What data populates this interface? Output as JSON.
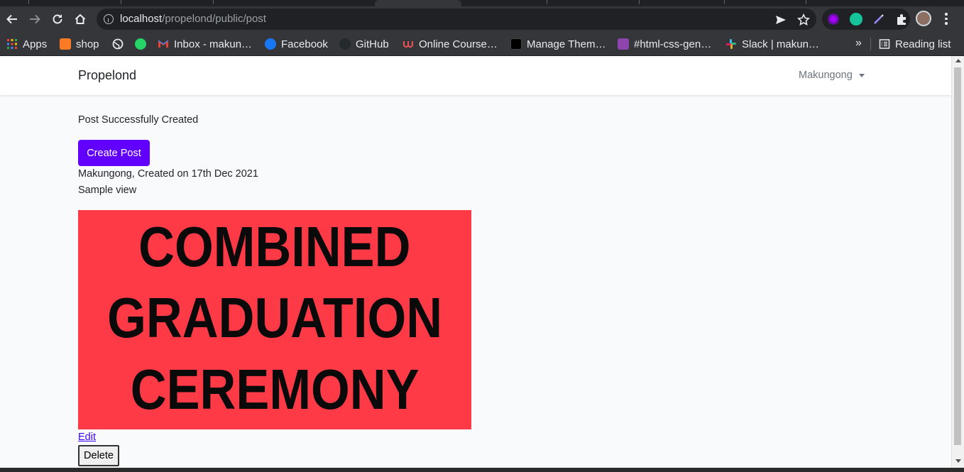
{
  "browser": {
    "url_host": "localhost",
    "url_path": "/propelond/public/post",
    "bookmarks": [
      {
        "label": "Apps",
        "icon": "apps-grid-icon",
        "color": "#ea4335"
      },
      {
        "label": "shop",
        "icon": "xampp-icon",
        "color": "#fb7a24"
      },
      {
        "label": "",
        "icon": "globe-icon",
        "color": "#e8eaed"
      },
      {
        "label": "",
        "icon": "whatsapp-icon",
        "color": "#25d366"
      },
      {
        "label": "Inbox - makun…",
        "icon": "gmail-icon",
        "color": "#ea4335"
      },
      {
        "label": "Facebook",
        "icon": "facebook-icon",
        "color": "#1877f2"
      },
      {
        "label": "GitHub",
        "icon": "github-icon",
        "color": "#24292e"
      },
      {
        "label": "Online Course…",
        "icon": "udemy-icon",
        "color": "#ec5252"
      },
      {
        "label": "Manage Them…",
        "icon": "themeforest-icon",
        "color": "#000000"
      },
      {
        "label": "#html-css-gen…",
        "icon": "discord-icon",
        "color": "#8e44ad"
      },
      {
        "label": "Slack | makun…",
        "icon": "slack-icon",
        "color": "#e01e5a"
      }
    ],
    "reading_list": "Reading list"
  },
  "navbar": {
    "brand": "Propelond",
    "user": "Makungong"
  },
  "page": {
    "flash_message": "Post Successfully Created",
    "create_button": "Create Post",
    "post_meta": "Makungong, Created on 17th Dec 2021",
    "post_title": "Sample view",
    "image_lines": [
      "COMBINED",
      "GRADUATION",
      "CEREMONY"
    ],
    "image_bg_color": "#ff3a47",
    "edit_link": "Edit",
    "delete_button": "Delete"
  },
  "colors": {
    "accent": "#6200ff"
  }
}
